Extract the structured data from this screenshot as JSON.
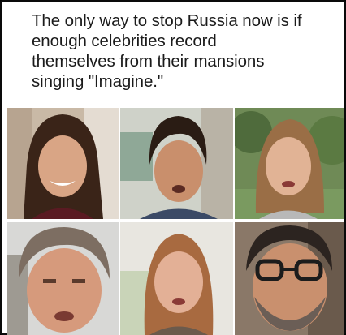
{
  "caption": {
    "lines": [
      "The only way to stop Russia now is if",
      "enough celebrities record",
      "themselves from their mansions",
      "singing \"Imagine.\""
    ]
  },
  "tiles": [
    {
      "name": "video-tile-1",
      "subject": "smiling woman, dark hair"
    },
    {
      "name": "video-tile-2",
      "subject": "man with wavy dark hair"
    },
    {
      "name": "video-tile-3",
      "subject": "woman outdoors, light brown hair"
    },
    {
      "name": "video-tile-4",
      "subject": "man with grey hair, close-up"
    },
    {
      "name": "video-tile-5",
      "subject": "woman with reddish hair"
    },
    {
      "name": "video-tile-6",
      "subject": "man with glasses and beard"
    }
  ]
}
